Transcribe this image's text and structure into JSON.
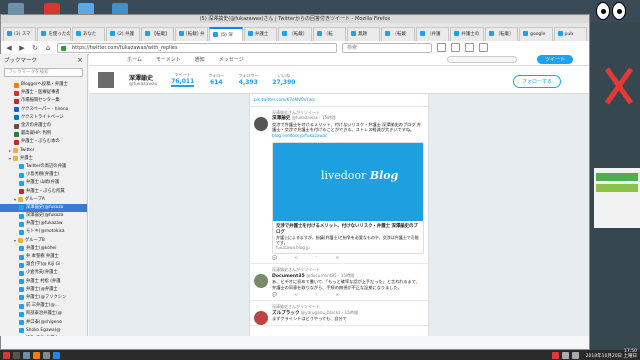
{
  "window": {
    "title": "(5) 深澤諭史(@fukazawas)さん | Twitterからの回答付きツイート - Mozilla Firefox"
  },
  "tabs": [
    {
      "label": "(3) スマ",
      "active": false
    },
    {
      "label": "を使ったの",
      "active": false
    },
    {
      "label": "あなた",
      "active": false
    },
    {
      "label": "(2) 弁護",
      "active": false
    },
    {
      "label": "【転載】",
      "active": false
    },
    {
      "label": "[転載] 弁",
      "active": false
    },
    {
      "label": "(5) 深",
      "active": true
    },
    {
      "label": "弁護士",
      "active": false
    },
    {
      "label": "〔転載〕",
      "active": false
    },
    {
      "label": "〔転",
      "active": false
    },
    {
      "label": "無題",
      "active": false
    },
    {
      "label": "〔転載",
      "active": false
    },
    {
      "label": "〔弁護",
      "active": false
    },
    {
      "label": "弁護士の",
      "active": false
    },
    {
      "label": "〔転載〕",
      "active": false
    },
    {
      "label": "google",
      "active": false
    },
    {
      "label": "pub",
      "active": false
    }
  ],
  "nav": {
    "url": "https://twitter.com/fukazawas/with_replies",
    "search_placeholder": "検索"
  },
  "sidebar": {
    "header": "ブックマーク",
    "search_placeholder": "ブックマークを検索",
    "items": [
      {
        "label": "Bloggerへ投稿・弁護士",
        "color": "#f57c00",
        "indent": 2,
        "sel": false
      },
      {
        "label": "弁護士・医療従事者",
        "color": "#d32f2f",
        "indent": 2,
        "sel": false
      },
      {
        "label": "市場振興センター集",
        "color": "#c62828",
        "indent": 2,
        "sel": false
      },
      {
        "label": "ククスペーパー - hirono",
        "color": "#1565c0",
        "indent": 2,
        "sel": false
      },
      {
        "label": "ククストライトページ",
        "color": "#0277bd",
        "indent": 2,
        "sel": false
      },
      {
        "label": "金沢の弁護士の",
        "color": "#6d4c41",
        "indent": 2,
        "sel": false
      },
      {
        "label": "最高裁HP: 判例",
        "color": "#2e7d32",
        "indent": 2,
        "sel": false
      },
      {
        "label": "弁護士・ぷらむ本の",
        "color": "#c62828",
        "indent": 2,
        "sel": false
      },
      {
        "label": "Twitter",
        "color": "",
        "indent": 1,
        "tw": "▸",
        "sel": false
      },
      {
        "label": "弁護士",
        "color": "",
        "indent": 1,
        "tw": "▾",
        "sel": false
      },
      {
        "label": "Twitterの周辺の弁護",
        "color": "#1da1f2",
        "indent": 3,
        "sel": false
      },
      {
        "label": "小島秀樹(弁護士)",
        "color": "#1da1f2",
        "indent": 3,
        "sel": false
      },
      {
        "label": "弁護士 山崎(弁護",
        "color": "#1da1f2",
        "indent": 3,
        "sel": false
      },
      {
        "label": "弁護士・ぷらむ所属",
        "color": "#c62828",
        "indent": 3,
        "sel": false
      },
      {
        "label": "グループA",
        "color": "",
        "indent": 2,
        "tw": "▾",
        "sel": false
      },
      {
        "label": "深澤諭史(@fukaza",
        "color": "#1da1f2",
        "indent": 3,
        "sel": true
      },
      {
        "label": "深澤諭史(@fukaza",
        "color": "#1da1f2",
        "indent": 3,
        "sel": false
      },
      {
        "label": "弁護士(@fukazaw",
        "color": "#1da1f2",
        "indent": 3,
        "sel": false
      },
      {
        "label": "モトキ(@motokisa",
        "color": "#1da1f2",
        "indent": 3,
        "sel": false
      },
      {
        "label": "グループB",
        "color": "",
        "indent": 2,
        "tw": "▾",
        "sel": false
      },
      {
        "label": "弁護士(@kohei",
        "color": "#1da1f2",
        "indent": 3,
        "sel": false
      },
      {
        "label": "弁 本聖樹 弁護士",
        "color": "#1da1f2",
        "indent": 3,
        "sel": false
      },
      {
        "label": "諏合(学(@ Kiji Gi",
        "color": "#1da1f2",
        "indent": 3,
        "sel": false
      },
      {
        "label": "小倉秀夫(弁護士",
        "color": "#1da1f2",
        "indent": 3,
        "sel": false
      },
      {
        "label": "弁護士 村松 (弁護",
        "color": "#1da1f2",
        "indent": 3,
        "sel": false
      },
      {
        "label": "弁護士(@弁護士",
        "color": "#1da1f2",
        "indent": 3,
        "sel": false
      },
      {
        "label": "弁護士(@フリクシン",
        "color": "#1da1f2",
        "indent": 3,
        "sel": false
      },
      {
        "label": "前 三弁護士(@...",
        "color": "#1da1f2",
        "indent": 3,
        "sel": false
      },
      {
        "label": "阿部泰治弁護士(@",
        "color": "#1da1f2",
        "indent": 3,
        "sel": false
      },
      {
        "label": "井口泰(@shigeno",
        "color": "#1da1f2",
        "indent": 3,
        "sel": false
      },
      {
        "label": "Shoko Egawa(@",
        "color": "#1da1f2",
        "indent": 3,
        "sel": false
      },
      {
        "label": "津久 真治 弁護士",
        "color": "#1da1f2",
        "indent": 3,
        "sel": false
      },
      {
        "label": "清水 弁(@Kaikoudo",
        "color": "#1da1f2",
        "indent": 3,
        "sel": false
      },
      {
        "label": "小島秀彰(@motoki",
        "color": "#1da1f2",
        "indent": 3,
        "sel": false
      },
      {
        "label": "モトキ(@motokisa",
        "color": "#1da1f2",
        "indent": 3,
        "sel": false
      },
      {
        "label": "弁護士のグループA",
        "color": "#1da1f2",
        "indent": 3,
        "sel": false
      }
    ]
  },
  "twitter": {
    "nav_items": [
      "ホーム",
      "モーメント",
      "通知",
      "メッセージ"
    ],
    "tweet_button": "ツイート",
    "profile": {
      "name": "深澤諭史",
      "handle": "@fukazawas"
    },
    "stats": [
      {
        "label": "ツイート",
        "value": "76,011",
        "active": true
      },
      {
        "label": "フォロー",
        "value": "614",
        "active": false
      },
      {
        "label": "フォロワー",
        "value": "4,393",
        "active": false
      },
      {
        "label": "いいね",
        "value": "27,390",
        "active": false
      }
    ],
    "follow_label": "フォローする",
    "tweets": [
      {
        "note": "",
        "name": "",
        "handle": "",
        "text": "",
        "link": "pic.twitter.com/K7eMV0xYwa",
        "avatar": false
      },
      {
        "note": "深澤諭史さんがリツイート",
        "name": "深澤諭史",
        "handle": "@fukazawas · 15時間",
        "text": "交渉で弁護士を付けるメリット、付けないリスク・弁護士 深澤諭史のブログ 弁護士・交渉で弁護士を付けることができる。ストレス軽減が大きいですね。",
        "link": "blog.livedoor.jp/fukazawa/",
        "avatar": true
      }
    ],
    "card": {
      "logo_a": "livedoor",
      "logo_b": "Blog",
      "title": "交渉で弁護士を付けるメリット、付けないリスク・弁護士 深澤諭史のブログ",
      "desc": "弁護士によるますが、紛議(弁護士)と紛争を必要なものや、交渉は弁護士で可能です。",
      "domain": "fukazawa.blog.jp"
    },
    "tweets2": [
      {
        "name": "Document35",
        "handle": "@document35 · 15時間",
        "text": "あ、ビデオに初めて書いて、「もっと確率な話が上手だった」と言われるまで、弁護士の同意を取りながら、手続の無視が不正な証拠になりました。",
        "note": "深澤諭史さんがリツイート"
      },
      {
        "name": "ズルブラック",
        "handle": "@yaruganu_blackz · 15時間",
        "text": "まずクライントはどうやっても、自分で",
        "note": "深澤諭史さんがリツイート"
      }
    ]
  },
  "clock": {
    "time": "17:50",
    "date": "2018年10月20日 土曜日"
  },
  "colors": {
    "twitter_blue": "#1da1f2",
    "livedoor_blue": "#1e9fe0",
    "selection": "#3a7bd5"
  }
}
